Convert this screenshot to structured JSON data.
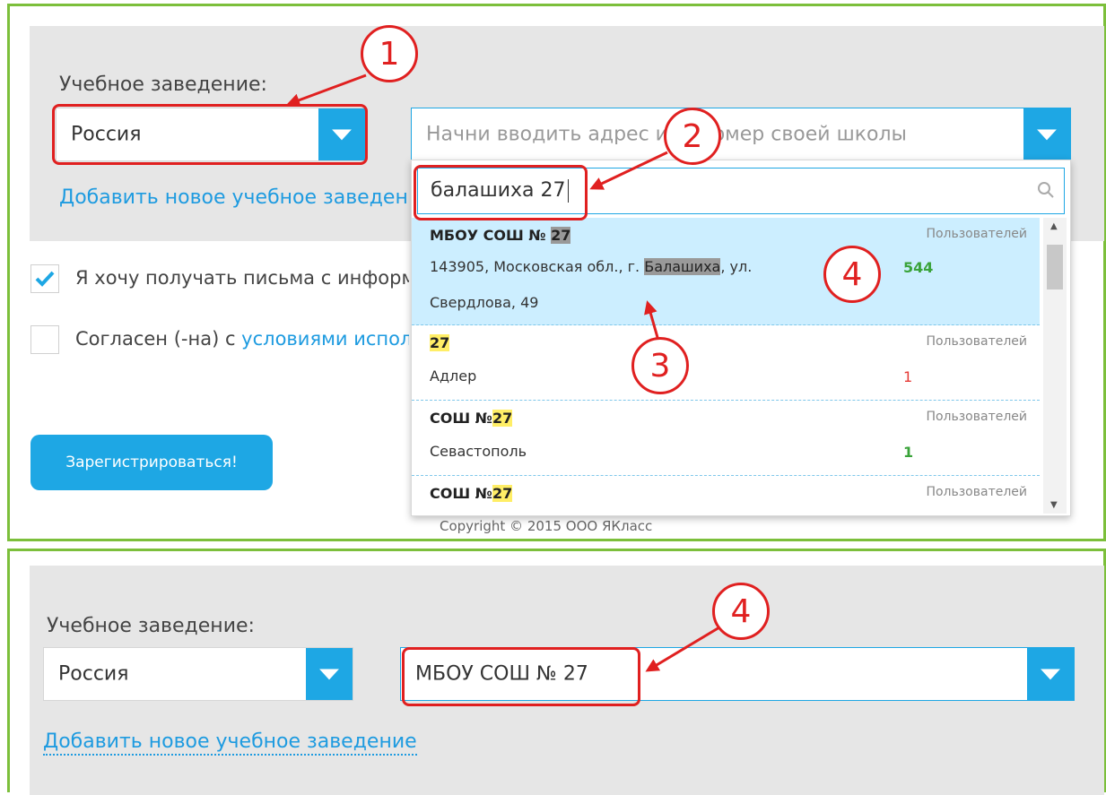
{
  "top": {
    "label": "Учебное заведение:",
    "country_value": "Россия",
    "school_placeholder": "Начни вводить адрес или номер своей школы",
    "add_link": "Добавить новое учебное заведение",
    "checkbox1_text": "Я хочу получать письма с информацией",
    "checkbox2_prefix": "Согласен (-на) с ",
    "checkbox2_link": "условиями использования",
    "register_button": "Зарегистрироваться!",
    "copyright": "Copyright © 2015 ООО ЯКласс",
    "dropdown": {
      "search_value": "балашиха 27",
      "items": [
        {
          "name_prefix": "МБОУ СОШ № ",
          "name_hl": "27",
          "address_l1_pre": "143905, Московская обл., г. ",
          "address_l1_hl": "Балашиха",
          "address_l1_post": ", ул.",
          "address_l2": "Свердлова, 49",
          "users_label": "Пользователей",
          "users_count": "544",
          "count_color": "#3aa33a"
        },
        {
          "name_prefix": "",
          "name_hl": "27",
          "address_l1_pre": "Адлер",
          "users_label": "Пользователей",
          "users_count": "1",
          "count_color": "#e53935"
        },
        {
          "name_prefix": "СОШ №",
          "name_hl": "27",
          "address_l1_pre": "Севастополь",
          "users_label": "Пользователей",
          "users_count": "1",
          "count_color": "#3aa33a"
        },
        {
          "name_prefix": "СОШ №",
          "name_hl": "27",
          "users_label": "Пользователей"
        }
      ]
    }
  },
  "bottom": {
    "label": "Учебное заведение:",
    "country_value": "Россия",
    "school_value": "МБОУ СОШ № 27",
    "add_link": "Добавить новое учебное заведение"
  },
  "annotations": [
    "1",
    "2",
    "3",
    "4",
    "4"
  ],
  "colors": {
    "accent": "#1ea7e4",
    "frame": "#7cbf3b",
    "annotation": "#e02020"
  }
}
